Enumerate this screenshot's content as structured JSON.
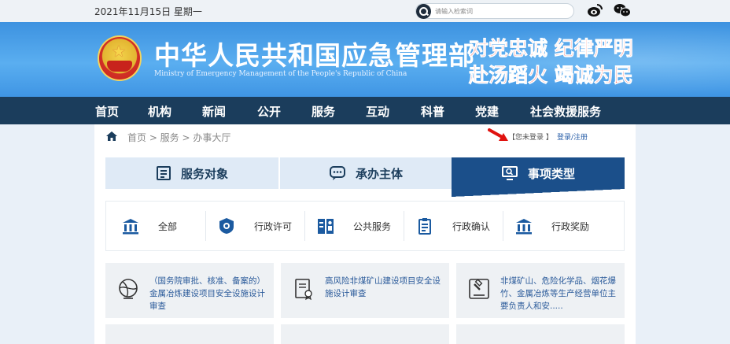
{
  "topbar": {
    "date": "2021年11月15日 星期一",
    "search_placeholder": "请输入检索词"
  },
  "banner": {
    "title": "中华人民共和国应急管理部",
    "subtitle": "Ministry of Emergency Management of the People's Republic of China",
    "slogan_line1": "对党忠诚 纪律严明",
    "slogan_line2": "赴汤蹈火 竭诚为民"
  },
  "nav": {
    "items": [
      "首页",
      "机构",
      "新闻",
      "公开",
      "服务",
      "互动",
      "科普",
      "党建",
      "社会救援服务"
    ]
  },
  "breadcrumb": {
    "text": "首页 > 服务 > 办事大厅"
  },
  "account": {
    "status": "【您未登录 】",
    "login_link": "登录/注册"
  },
  "tabs": [
    {
      "label": "服务对象",
      "icon": "document-icon"
    },
    {
      "label": "承办主体",
      "icon": "chat-icon"
    },
    {
      "label": "事项类型",
      "icon": "monitor-search-icon",
      "active": true
    }
  ],
  "categories": [
    {
      "label": "全部",
      "icon": "building-icon"
    },
    {
      "label": "行政许可",
      "icon": "badge-icon"
    },
    {
      "label": "公共服务",
      "icon": "people-icon"
    },
    {
      "label": "行政确认",
      "icon": "clipboard-icon"
    },
    {
      "label": "行政奖励",
      "icon": "building-icon"
    }
  ],
  "cards": [
    {
      "text": "（国务院审批、核准、备案的）金属冶炼建设项目安全设施设计审查",
      "icon": "globe-icon"
    },
    {
      "text": "高风险非煤矿山建设项目安全设施设计审查",
      "icon": "certificate-icon"
    },
    {
      "text": "非煤矿山、危险化学品、烟花爆竹、金属冶炼等生产经营单位主要负责人和安.....",
      "icon": "gavel-icon"
    }
  ],
  "colors": {
    "nav_bg": "#1b3d5c",
    "banner_blue": "#4aa0ea",
    "active_tab": "#1b4f8a",
    "slogan_red": "#ff2a1a"
  }
}
